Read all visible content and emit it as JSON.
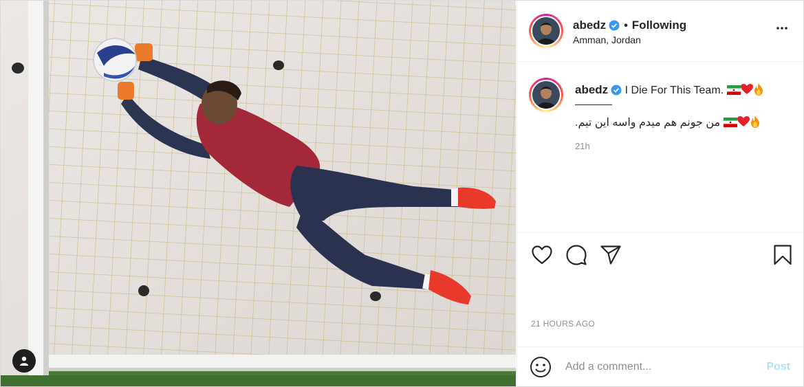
{
  "post": {
    "username": "abedz",
    "follow_status": "Following",
    "location": "Amman, Jordan",
    "caption_en": "I Die For This Team.",
    "caption_fa": ".من جونم هم میدم واسه این تیم",
    "caption_time": "21h",
    "timestamp": "21 HOURS AGO"
  },
  "comment": {
    "placeholder": "Add a comment...",
    "post_label": "Post"
  },
  "colors": {
    "verified": "#3897f0",
    "post_button_disabled": "#b2dffc",
    "muted_text": "#8e8e8e"
  },
  "icons": [
    "user-tag-icon",
    "verified-icon",
    "more-options-icon",
    "like-icon",
    "comment-icon",
    "share-icon",
    "save-icon",
    "emoji-icon",
    "iran-flag-icon",
    "heart-emoji-icon",
    "fire-emoji-icon"
  ]
}
